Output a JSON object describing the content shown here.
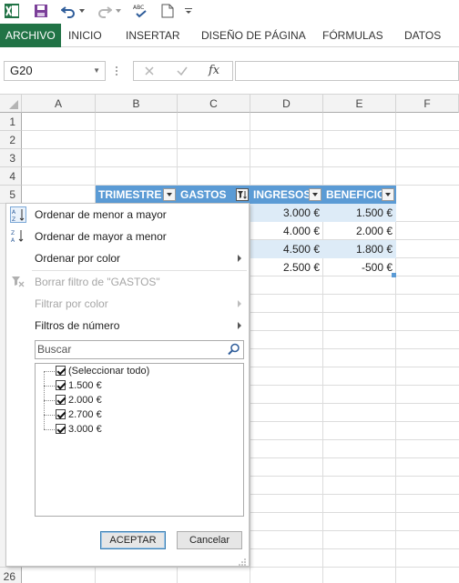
{
  "ribbon": {
    "tabs": [
      "ARCHIVO",
      "INICIO",
      "INSERTAR",
      "DISEÑO DE PÁGINA",
      "FÓRMULAS",
      "DATOS"
    ]
  },
  "formula_bar": {
    "name_box": "G20",
    "fx_label": "fx",
    "formula": ""
  },
  "grid": {
    "columns": [
      "A",
      "B",
      "C",
      "D",
      "E",
      "F"
    ],
    "rows": [
      "1",
      "2",
      "3",
      "4",
      "5",
      "26"
    ],
    "headers": [
      "TRIMESTRE",
      "GASTOS",
      "INGRESOS",
      "BENEFICIO"
    ],
    "ingresos": [
      "3.000 €",
      "4.000 €",
      "4.500 €",
      "2.500 €"
    ],
    "beneficio": [
      "1.500 €",
      "2.000 €",
      "1.800 €",
      "-500 €"
    ]
  },
  "filter_menu": {
    "sort_asc": "Ordenar de menor a mayor",
    "sort_desc": "Ordenar de mayor a menor",
    "sort_color": "Ordenar por color",
    "clear_filter": "Borrar filtro de \"GASTOS\"",
    "filter_color": "Filtrar por color",
    "number_filters": "Filtros de número",
    "search_placeholder": "Buscar",
    "items": [
      "(Seleccionar todo)",
      "1.500 €",
      "2.000 €",
      "2.700 €",
      "3.000 €"
    ],
    "ok": "ACEPTAR",
    "cancel": "Cancelar"
  },
  "colors": {
    "accent": "#217346",
    "table_header": "#5b9bd5",
    "table_band": "#ddebf7"
  }
}
